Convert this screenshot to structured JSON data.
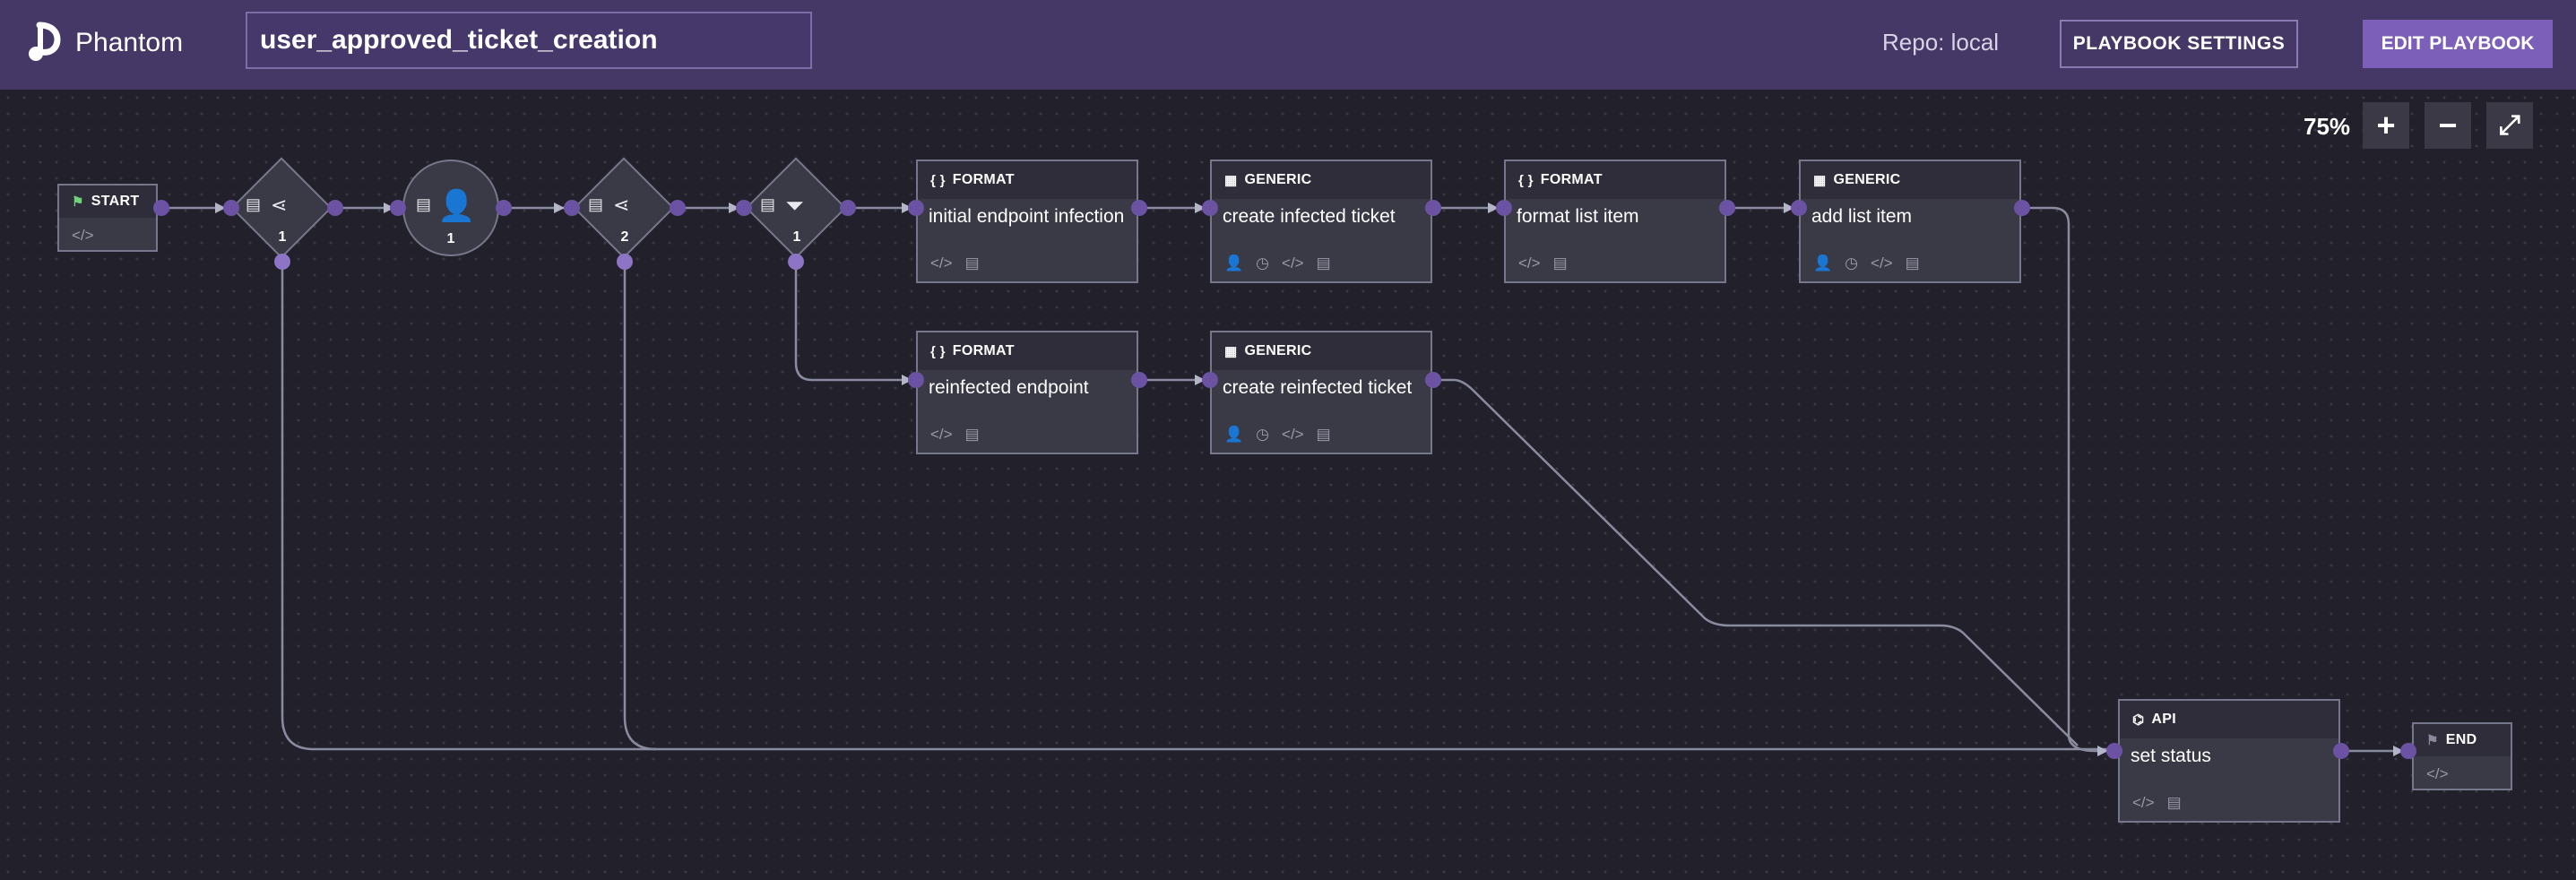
{
  "header": {
    "logo_text": "Phantom",
    "playbook_name": "user_approved_ticket_creation",
    "repo": "Repo: local",
    "settings_label": "PLAYBOOK SETTINGS",
    "edit_label": "EDIT PLAYBOOK"
  },
  "zoom": {
    "level": "75%",
    "in": "+",
    "out": "−",
    "fit": "⤢"
  },
  "nodes": {
    "start": {
      "type": "START"
    },
    "decision1": {
      "num": "1"
    },
    "prompt1": {
      "num": "1"
    },
    "decision2": {
      "num": "2"
    },
    "filter1": {
      "num": "1"
    },
    "format1": {
      "type": "FORMAT",
      "name": "initial endpoint infection"
    },
    "generic1": {
      "type": "GENERIC",
      "name": "create infected ticket"
    },
    "format2": {
      "type": "FORMAT",
      "name": "format list item"
    },
    "generic2": {
      "type": "GENERIC",
      "name": "add list item"
    },
    "format3": {
      "type": "FORMAT",
      "name": "reinfected endpoint"
    },
    "generic3": {
      "type": "GENERIC",
      "name": "create reinfected ticket"
    },
    "api1": {
      "type": "API",
      "name": "set status"
    },
    "end": {
      "type": "END"
    }
  },
  "colors": {
    "header_bg": "#463866",
    "canvas_bg": "#22212b",
    "node_bg": "#3a3946",
    "connector": "#6b52a3",
    "edit_button": "#7b5fb8",
    "start_flag": "#6fd17a"
  },
  "icons": {
    "code": "code-icon",
    "doc": "document-icon",
    "user": "user-icon",
    "clock": "clock-icon"
  }
}
